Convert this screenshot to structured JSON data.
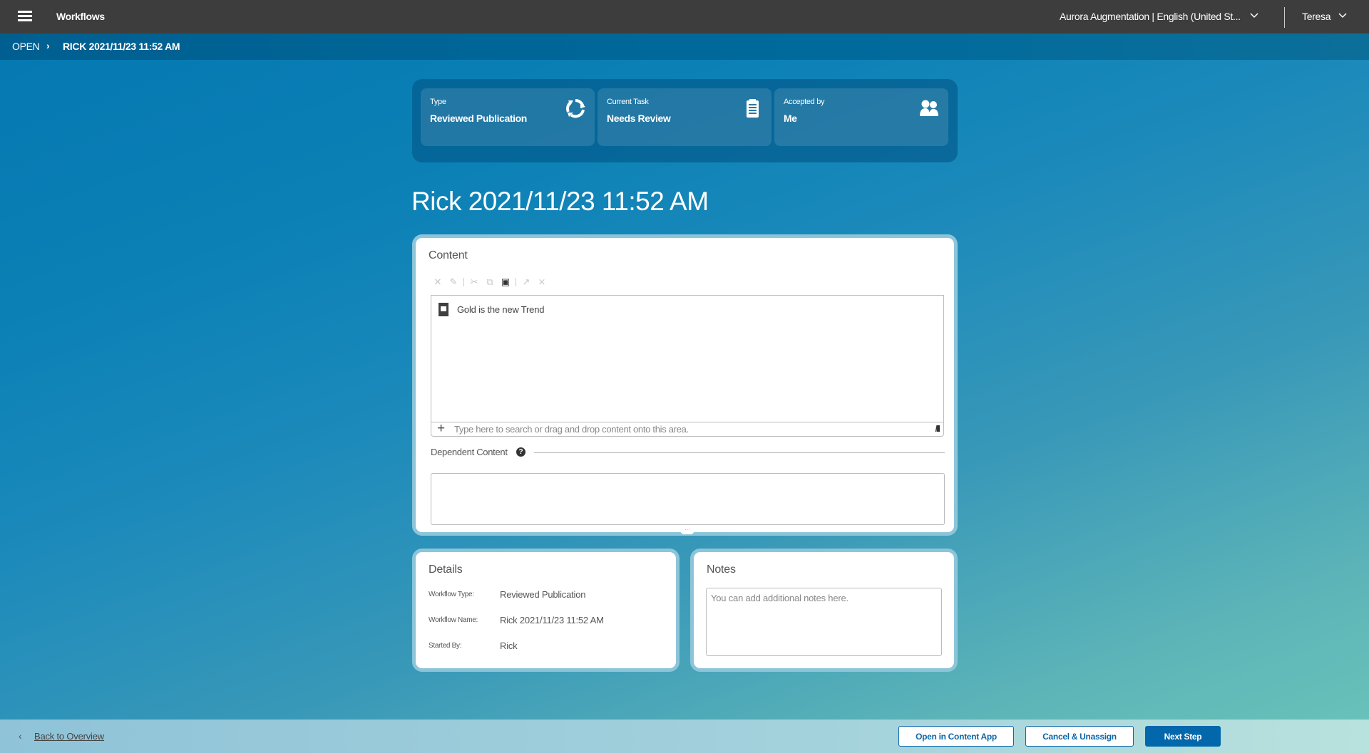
{
  "header": {
    "app_title": "Workflows",
    "tenant_selector": "Aurora Augmentation | English (United St...",
    "user_menu": "Teresa"
  },
  "breadcrumb": {
    "root": "OPEN",
    "separator": "›",
    "current": "RICK 2021/11/23 11:52 AM"
  },
  "summary": {
    "cards": [
      {
        "label": "Type",
        "value": "Reviewed Publication",
        "icon": "refresh-icon"
      },
      {
        "label": "Current Task",
        "value": "Needs Review",
        "icon": "clipboard-icon"
      },
      {
        "label": "Accepted by",
        "value": "Me",
        "icon": "users-icon"
      }
    ]
  },
  "page_title": "Rick 2021/11/23 11:52 AM",
  "content_panel": {
    "title": "Content",
    "toolbar": [
      {
        "name": "remove-icon",
        "glyph": "✕",
        "enabled": false
      },
      {
        "name": "edit-icon",
        "glyph": "✎",
        "enabled": false
      },
      {
        "name": "cut-icon",
        "glyph": "✂",
        "enabled": false
      },
      {
        "name": "copy-icon",
        "glyph": "⧉",
        "enabled": false
      },
      {
        "name": "paste-icon",
        "glyph": "▣",
        "enabled": true
      },
      {
        "name": "open-icon",
        "glyph": "↗",
        "enabled": false
      },
      {
        "name": "clear-icon",
        "glyph": "⨯",
        "enabled": false
      }
    ],
    "items": [
      {
        "title": "Gold is the new Trend"
      }
    ],
    "search_placeholder": "Type here to search or drag and drop content onto this area.",
    "library_glyph": "/lll",
    "dependent_label": "Dependent Content",
    "help_glyph": "?",
    "resize_glyph": "···"
  },
  "details_panel": {
    "title": "Details",
    "rows": [
      {
        "key": "Workflow Type:",
        "value": "Reviewed Publication"
      },
      {
        "key": "Workflow Name:",
        "value": "Rick 2021/11/23 11:52 AM"
      },
      {
        "key": "Started By:",
        "value": "Rick"
      }
    ]
  },
  "notes_panel": {
    "title": "Notes",
    "placeholder": "You can add additional notes here.",
    "value": ""
  },
  "footer": {
    "back_chevron": "‹",
    "back_label": "Back to Overview",
    "buttons": {
      "open_in_content_app": "Open in Content App",
      "cancel_unassign": "Cancel & Unassign",
      "next_step": "Next Step"
    }
  },
  "colors": {
    "topbar": "#3d3d3d",
    "primary_button": "#0367ac",
    "panel_border": "#8cc5d9"
  }
}
